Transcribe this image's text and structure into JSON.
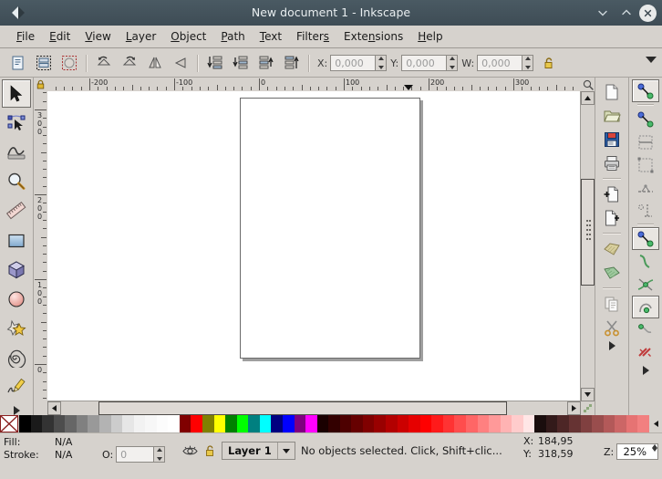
{
  "window": {
    "title": "New document 1 - Inkscape",
    "app_icon": "inkscape-diamond-icon",
    "buttons": [
      {
        "name": "minimize",
        "glyph": "chevron-down"
      },
      {
        "name": "maximize",
        "glyph": "chevron-up"
      },
      {
        "name": "close",
        "glyph": "x"
      }
    ]
  },
  "menubar": {
    "items": [
      {
        "label": "File",
        "mnemonic": 0
      },
      {
        "label": "Edit",
        "mnemonic": 0
      },
      {
        "label": "View",
        "mnemonic": 0
      },
      {
        "label": "Layer",
        "mnemonic": 0
      },
      {
        "label": "Object",
        "mnemonic": 0
      },
      {
        "label": "Path",
        "mnemonic": 0
      },
      {
        "label": "Text",
        "mnemonic": 0
      },
      {
        "label": "Filters",
        "mnemonic": 6
      },
      {
        "label": "Extensions",
        "mnemonic": 4
      },
      {
        "label": "Help",
        "mnemonic": 0
      }
    ]
  },
  "tool_controls": {
    "buttons": [
      {
        "name": "select-all-button"
      },
      {
        "name": "select-all-in-all-layers-button"
      },
      {
        "name": "deselect-button"
      },
      {
        "name": "rotate-90-ccw-button"
      },
      {
        "name": "rotate-90-cw-button"
      },
      {
        "name": "flip-horizontal-button"
      },
      {
        "name": "flip-vertical-button"
      },
      {
        "name": "lower-to-bottom-button"
      },
      {
        "name": "lower-one-step-button"
      },
      {
        "name": "raise-one-step-button"
      },
      {
        "name": "raise-to-top-button"
      }
    ],
    "fields": [
      {
        "name": "x-field",
        "label": "X:",
        "value": "0,000"
      },
      {
        "name": "y-field",
        "label": "Y:",
        "value": "0,000"
      },
      {
        "name": "w-field",
        "label": "W:",
        "value": "0,000"
      }
    ],
    "lock_ratio": "lock-open-icon",
    "overflow": "chevron-down-icon"
  },
  "toolbox": {
    "tools": [
      {
        "name": "selector-tool",
        "icon": "arrow-pointer-icon",
        "active": true
      },
      {
        "name": "node-tool",
        "icon": "node-editor-icon",
        "active": false
      },
      {
        "name": "tweak-tool",
        "icon": "tweak-icon",
        "active": false
      },
      {
        "name": "zoom-tool",
        "icon": "magnifier-icon",
        "active": false
      },
      {
        "name": "measure-tool",
        "icon": "ruler-icon",
        "active": false
      },
      {
        "name": "rectangle-tool",
        "icon": "rectangle-icon",
        "active": false
      },
      {
        "name": "box3d-tool",
        "icon": "cube-icon",
        "active": false
      },
      {
        "name": "ellipse-tool",
        "icon": "circle-icon",
        "active": false
      },
      {
        "name": "star-tool",
        "icon": "star-icon",
        "active": false
      },
      {
        "name": "spiral-tool",
        "icon": "spiral-icon",
        "active": false
      },
      {
        "name": "pencil-tool",
        "icon": "pencil-icon",
        "active": false
      }
    ],
    "overflow": "triangle-right-icon"
  },
  "rulers": {
    "unit_lock": "lock-closed-icon",
    "zoom_corner": "magnifier-icon",
    "horizontal_labels": [
      "-200",
      "-100",
      "0",
      "100",
      "200",
      "300"
    ],
    "vertical_labels": [
      "300",
      "200",
      "100",
      "0"
    ],
    "marker": "pointer-marker"
  },
  "canvas": {
    "page": {
      "name": "document-page",
      "shadow": true
    },
    "background": "#ffffff",
    "page_fill": "#ffffff",
    "page_border": "#6b6b6b"
  },
  "scrollbars": {
    "vertical": {
      "up": "triangle-up-icon",
      "down": "triangle-down-icon"
    },
    "horizontal": {
      "left": "triangle-left-icon",
      "right": "triangle-right-icon"
    },
    "corner": "resize-grip-icon"
  },
  "commands_bar": {
    "items": [
      {
        "name": "new-document-button",
        "icon": "page-icon"
      },
      {
        "name": "open-document-button",
        "icon": "folder-icon"
      },
      {
        "name": "save-document-button",
        "icon": "floppy-icon"
      },
      {
        "name": "print-document-button",
        "icon": "printer-icon"
      },
      {
        "name": "separator-1",
        "icon": "separator"
      },
      {
        "name": "import-button",
        "icon": "page-plus-icon"
      },
      {
        "name": "export-button",
        "icon": "page-arrow-icon"
      },
      {
        "name": "separator-2",
        "icon": "separator"
      },
      {
        "name": "undo-button",
        "icon": "undo-arrow-icon"
      },
      {
        "name": "redo-button",
        "icon": "redo-arrow-icon"
      },
      {
        "name": "separator-3",
        "icon": "separator"
      },
      {
        "name": "copy-button",
        "icon": "copy-icon"
      },
      {
        "name": "cut-button",
        "icon": "scissors-icon"
      }
    ],
    "overflow": "triangle-right-icon"
  },
  "snap_bar": {
    "items": [
      {
        "name": "enable-snapping-button",
        "icon": "snap-icon",
        "active": true
      },
      {
        "name": "separator-1",
        "icon": "separator"
      },
      {
        "name": "snap-bounding-boxes-button",
        "icon": "snap-bbox-icon",
        "active": false
      },
      {
        "name": "snap-bbox-edges-button",
        "icon": "snap-bbox-edge-icon",
        "active": false
      },
      {
        "name": "snap-bbox-corners-button",
        "icon": "snap-bbox-corner-icon",
        "active": false
      },
      {
        "name": "snap-bbox-edge-midpoints-button",
        "icon": "snap-edge-mid-icon",
        "active": false
      },
      {
        "name": "snap-bbox-centers-button",
        "icon": "snap-center-icon",
        "active": false
      },
      {
        "name": "separator-2",
        "icon": "separator"
      },
      {
        "name": "snap-nodes-paths-button",
        "icon": "snap-node-icon",
        "active": true
      },
      {
        "name": "snap-paths-button",
        "icon": "snap-path-icon",
        "active": false
      },
      {
        "name": "snap-path-intersections-button",
        "icon": "snap-intersect-icon",
        "active": false
      },
      {
        "name": "snap-to-nodes-button",
        "icon": "snap-cusp-icon",
        "active": true
      },
      {
        "name": "snap-smooth-nodes-button",
        "icon": "snap-smooth-icon",
        "active": false
      },
      {
        "name": "snap-midpoints-button",
        "icon": "snap-midpoint-icon",
        "active": false
      }
    ],
    "overflow": "triangle-right-icon"
  },
  "palette": {
    "none_swatch": {
      "name": "no-color-swatch",
      "glyph": "x-cross"
    },
    "scroll_arrow": "triangle-left-icon",
    "colors": [
      "#000000",
      "#1a1a1a",
      "#333333",
      "#4d4d4d",
      "#666666",
      "#808080",
      "#999999",
      "#b3b3b3",
      "#cccccc",
      "#e6e6e6",
      "#f2f2f2",
      "#f7f7f7",
      "#fcfcfc",
      "#ffffff",
      "#800000",
      "#ff0000",
      "#808000",
      "#ffff00",
      "#008000",
      "#00ff00",
      "#008080",
      "#00ffff",
      "#000080",
      "#0000ff",
      "#800080",
      "#ff00ff",
      "#1a0000",
      "#330000",
      "#4d0000",
      "#660000",
      "#800000",
      "#990000",
      "#b30000",
      "#cc0000",
      "#e60000",
      "#ff0000",
      "#ff1a1a",
      "#ff3333",
      "#ff4d4d",
      "#ff6666",
      "#ff8080",
      "#ff9999",
      "#ffb3b3",
      "#ffcccc",
      "#ffe6e6",
      "#1a0d0d",
      "#331a1a",
      "#4d2626",
      "#663333",
      "#804040",
      "#994d4d",
      "#b35959",
      "#cc6666",
      "#e67373",
      "#f28080"
    ]
  },
  "status_bar": {
    "fill_label": "Fill:",
    "fill_value": "N/A",
    "stroke_label": "Stroke:",
    "stroke_value": "N/A",
    "opacity_label": "O:",
    "opacity_value": "0",
    "visibility_icon": "eye-icon",
    "lock_icon": "lock-open-icon",
    "layer_name": "Layer 1",
    "layer_caret": "chevron-down-icon",
    "message": "No objects selected. Click, Shift+clic...",
    "coord_x_label": "X:",
    "coord_x_value": "184,95",
    "coord_y_label": "Y:",
    "coord_y_value": "318,59",
    "zoom_label": "Z:",
    "zoom_value": "25%"
  }
}
